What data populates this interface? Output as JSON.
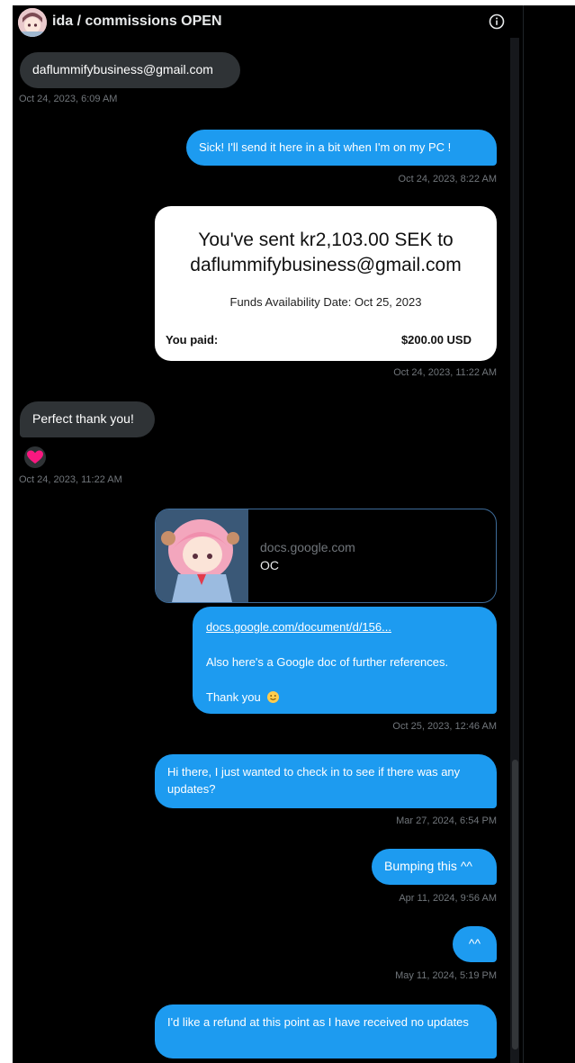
{
  "header": {
    "title": "ida / commissions OPEN",
    "info_icon": "info-circle-icon"
  },
  "messages": [
    {
      "dir": "in",
      "text": "daflummifybusiness@gmail.com",
      "time": "Oct 24, 2023, 6:09 AM"
    },
    {
      "dir": "out",
      "text": "Sick! I'll send it here in a bit when I'm on my PC !",
      "time": "Oct 24, 2023, 8:22 AM"
    },
    {
      "dir": "out",
      "type": "image",
      "time": "Oct 24, 2023, 11:22 AM"
    },
    {
      "dir": "in",
      "text": "Perfect thank you!",
      "reaction": "heart",
      "time": "Oct 24, 2023, 11:22 AM"
    },
    {
      "dir": "out",
      "type": "link",
      "link_text": "docs.google.com/document/d/156...",
      "text": "Also here's a Google doc of further references.",
      "thanks": "Thank you",
      "time": "Oct 25, 2023, 12:46 AM"
    },
    {
      "dir": "out",
      "text": "Hi there, I just wanted to check in to see if there was any updates?",
      "time": "Mar 27, 2024, 6:54 PM"
    },
    {
      "dir": "out",
      "text": "Bumping this ^^",
      "time": "Apr 11, 2024, 9:56 AM"
    },
    {
      "dir": "out",
      "text": "^^",
      "time": "May 11, 2024, 5:19 PM"
    },
    {
      "dir": "out",
      "text": "I'd like a refund at this point as I have received no updates"
    }
  ],
  "payment_card": {
    "line1": "You've sent kr2,103.00 SEK to",
    "line2": "daflummifybusiness@gmail.com",
    "funds": "Funds Availability Date: Oct 25, 2023",
    "paid_label": "You paid:",
    "paid_value": "$200.00 USD"
  },
  "link_preview": {
    "domain": "docs.google.com",
    "title": "OC"
  },
  "colors": {
    "outgoing": "#1d9bf0",
    "incoming": "#2f3336",
    "background": "#000000",
    "timestamp": "#71767b"
  }
}
